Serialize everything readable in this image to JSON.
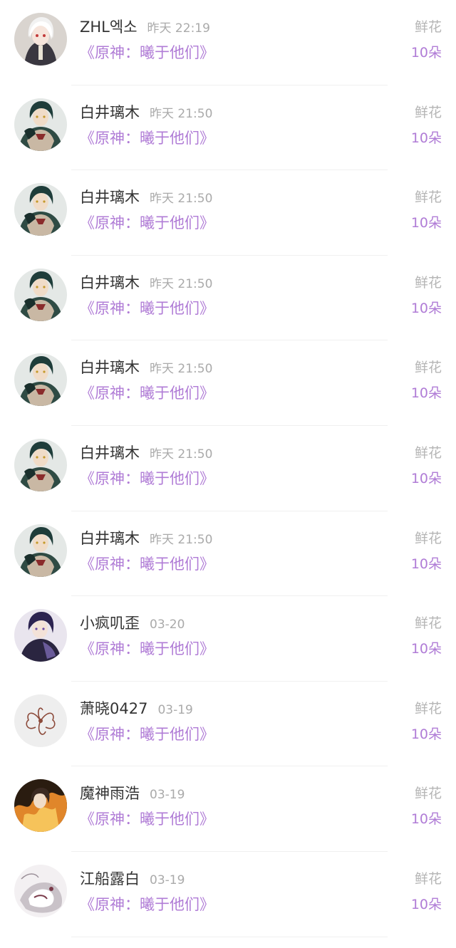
{
  "list": {
    "items": [
      {
        "user": "ZHL엑소",
        "time": "昨天 22:19",
        "book": "《原神：曦于他们》",
        "gift": "鲜花",
        "count": "10朵",
        "avatar": "avatar-white-hair"
      },
      {
        "user": "白井璃木",
        "time": "昨天 21:50",
        "book": "《原神：曦于他们》",
        "gift": "鲜花",
        "count": "10朵",
        "avatar": "avatar-green-hair"
      },
      {
        "user": "白井璃木",
        "time": "昨天 21:50",
        "book": "《原神：曦于他们》",
        "gift": "鲜花",
        "count": "10朵",
        "avatar": "avatar-green-hair"
      },
      {
        "user": "白井璃木",
        "time": "昨天 21:50",
        "book": "《原神：曦于他们》",
        "gift": "鲜花",
        "count": "10朵",
        "avatar": "avatar-green-hair"
      },
      {
        "user": "白井璃木",
        "time": "昨天 21:50",
        "book": "《原神：曦于他们》",
        "gift": "鲜花",
        "count": "10朵",
        "avatar": "avatar-green-hair"
      },
      {
        "user": "白井璃木",
        "time": "昨天 21:50",
        "book": "《原神：曦于他们》",
        "gift": "鲜花",
        "count": "10朵",
        "avatar": "avatar-green-hair"
      },
      {
        "user": "白井璃木",
        "time": "昨天 21:50",
        "book": "《原神：曦于他们》",
        "gift": "鲜花",
        "count": "10朵",
        "avatar": "avatar-green-hair"
      },
      {
        "user": "小疯叽歪",
        "time": "03-20",
        "book": "《原神：曦于他们》",
        "gift": "鲜花",
        "count": "10朵",
        "avatar": "avatar-dark-hair"
      },
      {
        "user": "萧晓0427",
        "time": "03-19",
        "book": "《原神：曦于他们》",
        "gift": "鲜花",
        "count": "10朵",
        "avatar": "avatar-flower"
      },
      {
        "user": "魔神雨浩",
        "time": "03-19",
        "book": "《原神：曦于他们》",
        "gift": "鲜花",
        "count": "10朵",
        "avatar": "avatar-fire"
      },
      {
        "user": "江船露白",
        "time": "03-19",
        "book": "《原神：曦于他们》",
        "gift": "鲜花",
        "count": "10朵",
        "avatar": "avatar-sketch"
      }
    ]
  },
  "colors": {
    "accent": "#b07cd6",
    "name": "#333333",
    "muted": "#aaaaaa",
    "divider": "#f0f0f0"
  }
}
